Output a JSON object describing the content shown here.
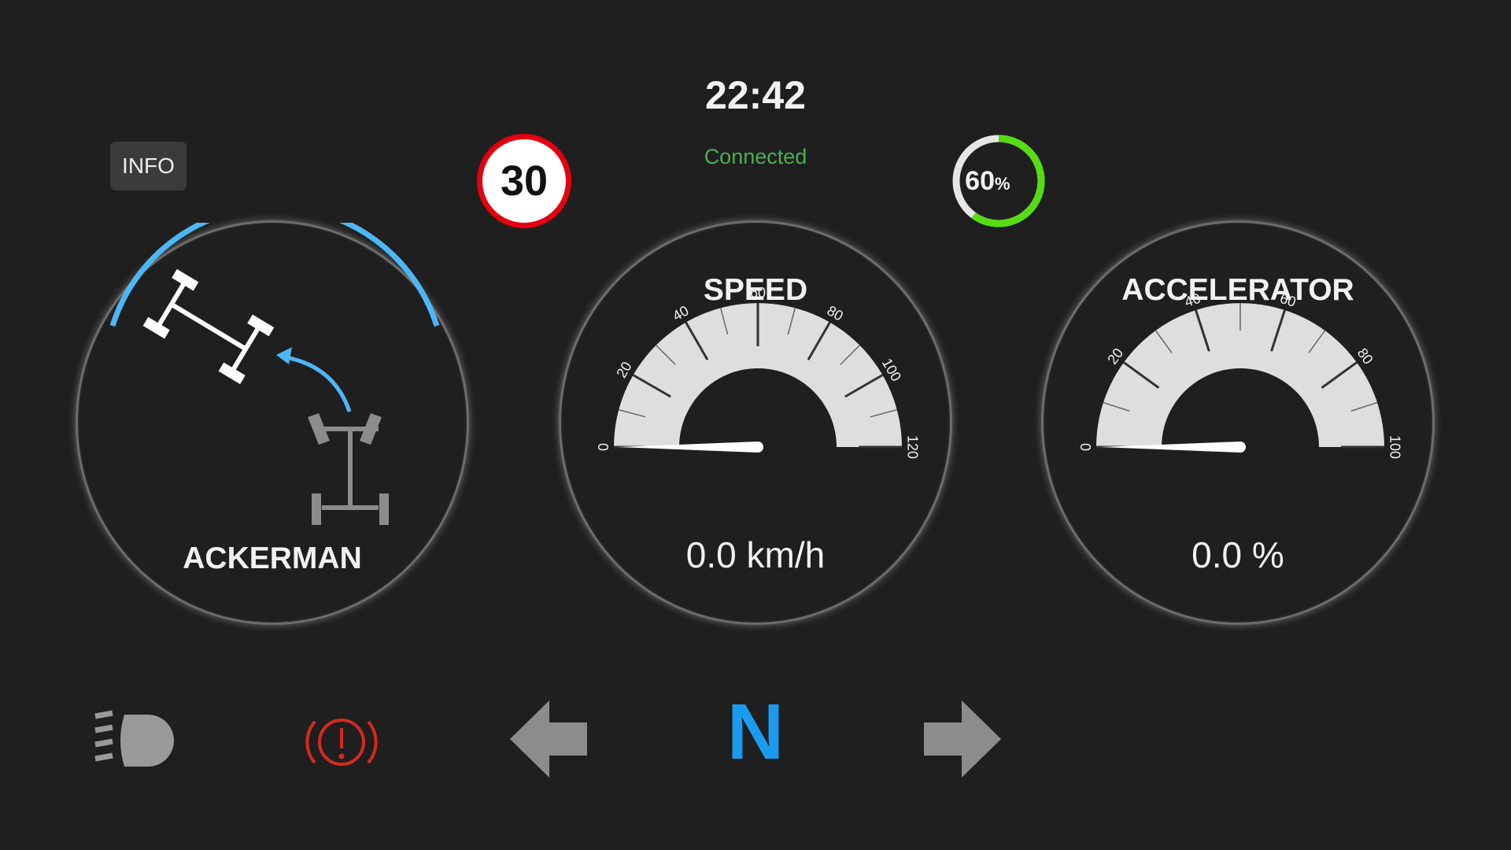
{
  "header": {
    "clock": "22:42",
    "connection_status": "Connected",
    "connection_color": "#4caf50"
  },
  "info_button": {
    "label": "INFO"
  },
  "speed_limit": {
    "value": "30",
    "ring_color": "#e3000f"
  },
  "battery": {
    "percent_value": 60,
    "number": "60",
    "unit": "%",
    "fill_color": "#55dd11",
    "track_color": "#e6e6e6"
  },
  "steering_mode": {
    "label": "ACKERMAN",
    "arc_color": "#4db6f7",
    "icon": "axle-pivot-icon"
  },
  "speed_gauge": {
    "title": "SPEED",
    "value": 0.0,
    "display": "0.0 km/h",
    "min": 0,
    "max": 120,
    "tick_labels": [
      "0",
      "20",
      "40",
      "60",
      "80",
      "100",
      "120"
    ]
  },
  "accelerator_gauge": {
    "title": "ACCELERATOR",
    "value": 0.0,
    "display": "0.0 %",
    "min": 0,
    "max": 100,
    "tick_labels": [
      "0",
      "20",
      "40",
      "60",
      "80",
      "100"
    ]
  },
  "indicators": {
    "headlight": {
      "icon": "headlight-icon",
      "color": "#9a9a9a"
    },
    "brake_warning": {
      "icon": "brake-warning-icon",
      "color": "#d42a1f"
    },
    "left_turn": {
      "icon": "left-arrow-icon",
      "color": "#8c8c8c"
    },
    "gear": {
      "value": "N",
      "color": "#1a9bf0"
    },
    "right_turn": {
      "icon": "right-arrow-icon",
      "color": "#8c8c8c"
    }
  }
}
